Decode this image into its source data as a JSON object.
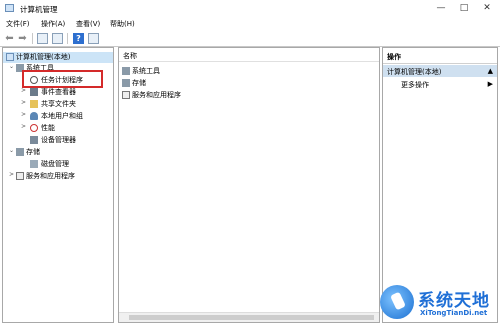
{
  "window": {
    "title": "计算机管理",
    "controls": {
      "minimize": "—",
      "maximize": "□",
      "close": "✕"
    }
  },
  "menu": [
    "文件(F)",
    "操作(A)",
    "查看(V)",
    "帮助(H)"
  ],
  "toolbar": {
    "back": "back-arrow-icon",
    "forward": "forward-arrow-icon",
    "help_glyph": "?"
  },
  "tree": {
    "root": "计算机管理(本地)",
    "system_tools": "系统工具",
    "task_scheduler": "任务计划程序",
    "event_viewer": "事件查看器",
    "shared_folders": "共享文件夹",
    "local_users": "本地用户和组",
    "performance": "性能",
    "device_manager": "设备管理器",
    "storage": "存储",
    "disk_management": "磁盘管理",
    "services": "服务和应用程序",
    "expand_collapsed": ">",
    "expand_open": "⌄"
  },
  "main": {
    "column_header": "名称",
    "items": [
      "系统工具",
      "存储",
      "服务和应用程序"
    ]
  },
  "actions": {
    "header": "操作",
    "section": "计算机管理(本地)",
    "more": "更多操作",
    "caret": "▲",
    "more_caret": "▶"
  },
  "watermark": {
    "title": "系统天地",
    "url": "XiTongTianDi.net"
  }
}
